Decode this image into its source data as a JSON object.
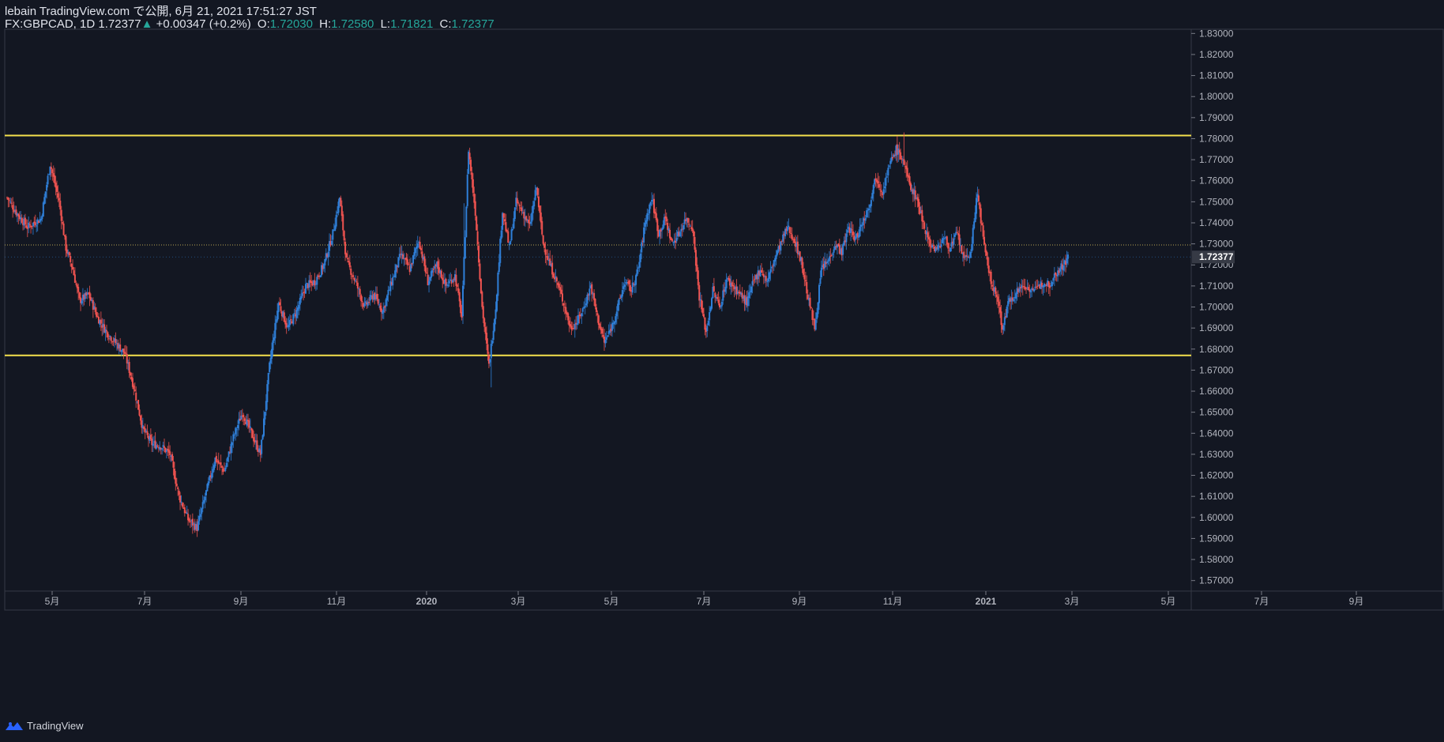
{
  "header": {
    "publish_line": "lebain TradingView.com で公開, 6月 21, 2021 17:51:27 JST",
    "symbol": "FX:GBPCAD, 1D",
    "last": "1.72377",
    "change": "+0.00347 (+0.2%)",
    "open_label": "O:",
    "open": "1.72030",
    "high_label": "H:",
    "high": "1.72580",
    "low_label": "L:",
    "low": "1.71821",
    "close_label": "C:",
    "close": "1.72377"
  },
  "footer": {
    "brand": "TradingView"
  },
  "colors": {
    "background": "#131722",
    "up": "#2f7fd8",
    "down": "#ef5350",
    "level_line": "#f5e14d",
    "dotted_line": "#b8a552",
    "axis_text": "#b2b5be"
  },
  "chart_data": {
    "type": "candlestick",
    "symbol": "FX:GBPCAD",
    "interval": "1D",
    "ylim": [
      1.565,
      1.832
    ],
    "y_ticks": [
      "1.83000",
      "1.82000",
      "1.81000",
      "1.80000",
      "1.79000",
      "1.78000",
      "1.77000",
      "1.76000",
      "1.75000",
      "1.74000",
      "1.73000",
      "1.72000",
      "1.71000",
      "1.70000",
      "1.69000",
      "1.68000",
      "1.67000",
      "1.66000",
      "1.65000",
      "1.64000",
      "1.63000",
      "1.62000",
      "1.61000",
      "1.60000",
      "1.59000",
      "1.58000",
      "1.57000"
    ],
    "x_ticks": [
      "5月",
      "7月",
      "9月",
      "11月",
      "2020",
      "3月",
      "5月",
      "7月",
      "9月",
      "11月",
      "2021",
      "3月",
      "5月",
      "7月",
      "9月"
    ],
    "last_price_label": "1.72377",
    "horizontal_lines": [
      {
        "price": 1.7815,
        "style": "solid",
        "color": "#f5e14d"
      },
      {
        "price": 1.677,
        "style": "solid",
        "color": "#f5e14d"
      },
      {
        "price": 1.7295,
        "style": "dotted",
        "color": "#b8a552"
      }
    ],
    "close_path": [
      [
        0,
        1.752
      ],
      [
        8,
        1.745
      ],
      [
        18,
        1.738
      ],
      [
        30,
        1.742
      ],
      [
        38,
        1.768
      ],
      [
        46,
        1.75
      ],
      [
        52,
        1.728
      ],
      [
        58,
        1.718
      ],
      [
        64,
        1.703
      ],
      [
        72,
        1.706
      ],
      [
        80,
        1.695
      ],
      [
        88,
        1.688
      ],
      [
        96,
        1.683
      ],
      [
        104,
        1.678
      ],
      [
        112,
        1.662
      ],
      [
        120,
        1.642
      ],
      [
        128,
        1.635
      ],
      [
        136,
        1.634
      ],
      [
        144,
        1.63
      ],
      [
        152,
        1.61
      ],
      [
        160,
        1.599
      ],
      [
        168,
        1.595
      ],
      [
        176,
        1.612
      ],
      [
        184,
        1.628
      ],
      [
        192,
        1.622
      ],
      [
        200,
        1.638
      ],
      [
        208,
        1.65
      ],
      [
        216,
        1.64
      ],
      [
        224,
        1.63
      ],
      [
        232,
        1.672
      ],
      [
        240,
        1.702
      ],
      [
        248,
        1.69
      ],
      [
        256,
        1.698
      ],
      [
        264,
        1.71
      ],
      [
        272,
        1.712
      ],
      [
        280,
        1.72
      ],
      [
        288,
        1.735
      ],
      [
        294,
        1.752
      ],
      [
        300,
        1.722
      ],
      [
        308,
        1.712
      ],
      [
        316,
        1.7
      ],
      [
        324,
        1.706
      ],
      [
        332,
        1.698
      ],
      [
        340,
        1.712
      ],
      [
        348,
        1.725
      ],
      [
        356,
        1.718
      ],
      [
        364,
        1.732
      ],
      [
        372,
        1.712
      ],
      [
        380,
        1.72
      ],
      [
        388,
        1.71
      ],
      [
        396,
        1.715
      ],
      [
        402,
        1.695
      ],
      [
        408,
        1.775
      ],
      [
        414,
        1.745
      ],
      [
        420,
        1.7
      ],
      [
        426,
        1.672
      ],
      [
        432,
        1.7
      ],
      [
        438,
        1.746
      ],
      [
        444,
        1.728
      ],
      [
        450,
        1.75
      ],
      [
        456,
        1.745
      ],
      [
        462,
        1.738
      ],
      [
        468,
        1.757
      ],
      [
        474,
        1.73
      ],
      [
        480,
        1.72
      ],
      [
        486,
        1.712
      ],
      [
        492,
        1.702
      ],
      [
        498,
        1.69
      ],
      [
        504,
        1.693
      ],
      [
        510,
        1.7
      ],
      [
        516,
        1.71
      ],
      [
        522,
        1.695
      ],
      [
        528,
        1.683
      ],
      [
        534,
        1.69
      ],
      [
        540,
        1.7
      ],
      [
        546,
        1.712
      ],
      [
        552,
        1.708
      ],
      [
        558,
        1.718
      ],
      [
        564,
        1.74
      ],
      [
        570,
        1.752
      ],
      [
        576,
        1.735
      ],
      [
        582,
        1.742
      ],
      [
        588,
        1.73
      ],
      [
        594,
        1.735
      ],
      [
        600,
        1.742
      ],
      [
        606,
        1.738
      ],
      [
        612,
        1.705
      ],
      [
        618,
        1.688
      ],
      [
        624,
        1.708
      ],
      [
        630,
        1.7
      ],
      [
        636,
        1.713
      ],
      [
        642,
        1.71
      ],
      [
        648,
        1.706
      ],
      [
        654,
        1.702
      ],
      [
        660,
        1.712
      ],
      [
        666,
        1.718
      ],
      [
        672,
        1.712
      ],
      [
        678,
        1.722
      ],
      [
        684,
        1.73
      ],
      [
        690,
        1.738
      ],
      [
        696,
        1.732
      ],
      [
        702,
        1.722
      ],
      [
        708,
        1.705
      ],
      [
        714,
        1.69
      ],
      [
        720,
        1.718
      ],
      [
        726,
        1.722
      ],
      [
        732,
        1.73
      ],
      [
        738,
        1.726
      ],
      [
        744,
        1.738
      ],
      [
        750,
        1.732
      ],
      [
        756,
        1.74
      ],
      [
        762,
        1.748
      ],
      [
        768,
        1.762
      ],
      [
        774,
        1.755
      ],
      [
        780,
        1.767
      ],
      [
        786,
        1.775
      ],
      [
        792,
        1.77
      ],
      [
        798,
        1.758
      ],
      [
        804,
        1.752
      ],
      [
        810,
        1.74
      ],
      [
        816,
        1.73
      ],
      [
        822,
        1.727
      ],
      [
        828,
        1.733
      ],
      [
        834,
        1.728
      ],
      [
        840,
        1.735
      ],
      [
        846,
        1.722
      ],
      [
        852,
        1.726
      ],
      [
        858,
        1.755
      ],
      [
        864,
        1.728
      ],
      [
        870,
        1.712
      ],
      [
        876,
        1.703
      ],
      [
        880,
        1.69
      ],
      [
        886,
        1.703
      ],
      [
        892,
        1.707
      ],
      [
        898,
        1.71
      ],
      [
        904,
        1.709
      ],
      [
        910,
        1.708
      ],
      [
        916,
        1.712
      ],
      [
        922,
        1.711
      ],
      [
        928,
        1.717
      ],
      [
        934,
        1.72
      ],
      [
        938,
        1.7238
      ]
    ]
  }
}
